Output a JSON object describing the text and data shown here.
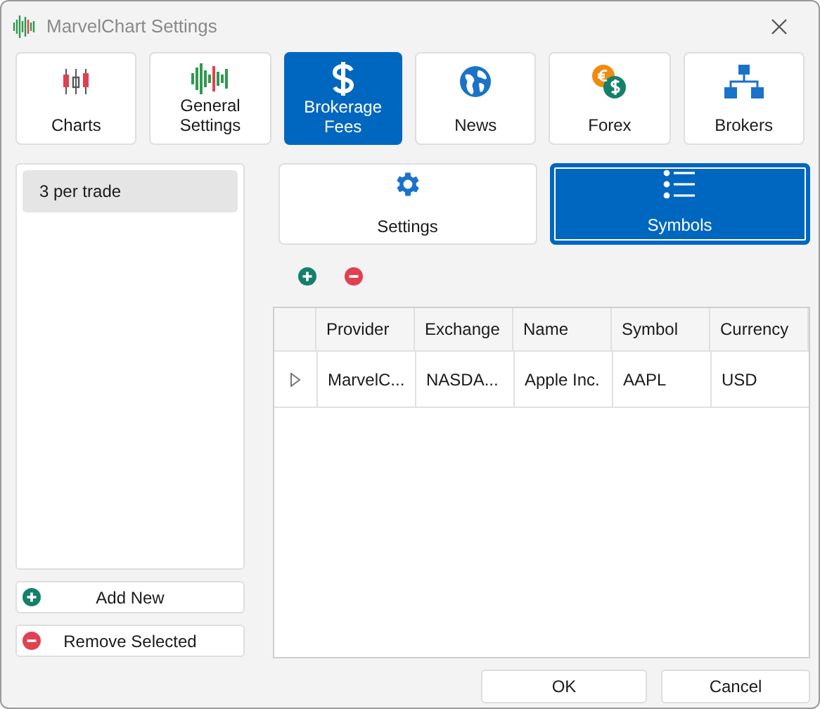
{
  "window": {
    "title": "MarvelChart Settings"
  },
  "tabs": [
    {
      "label": "Charts",
      "selected": false
    },
    {
      "label": "General Settings",
      "selected": false
    },
    {
      "label": "Brokerage Fees",
      "selected": true
    },
    {
      "label": "News",
      "selected": false
    },
    {
      "label": "Forex",
      "selected": false
    },
    {
      "label": "Brokers",
      "selected": false
    }
  ],
  "fee_list": {
    "items": [
      {
        "label": "3 per trade",
        "selected": true
      }
    ]
  },
  "list_buttons": [
    "Add New",
    "Remove Selected"
  ],
  "subtabs": [
    {
      "label": "Settings",
      "selected": false
    },
    {
      "label": "Symbols",
      "selected": true
    }
  ],
  "table": {
    "columns": [
      "Provider",
      "Exchange",
      "Name",
      "Symbol",
      "Currency"
    ],
    "rows": [
      {
        "expanded": false,
        "cells": [
          "MarvelC...",
          "NASDA...",
          "Apple Inc.",
          "AAPL",
          "USD"
        ]
      }
    ]
  },
  "buttons": [
    "OK",
    "Cancel"
  ]
}
